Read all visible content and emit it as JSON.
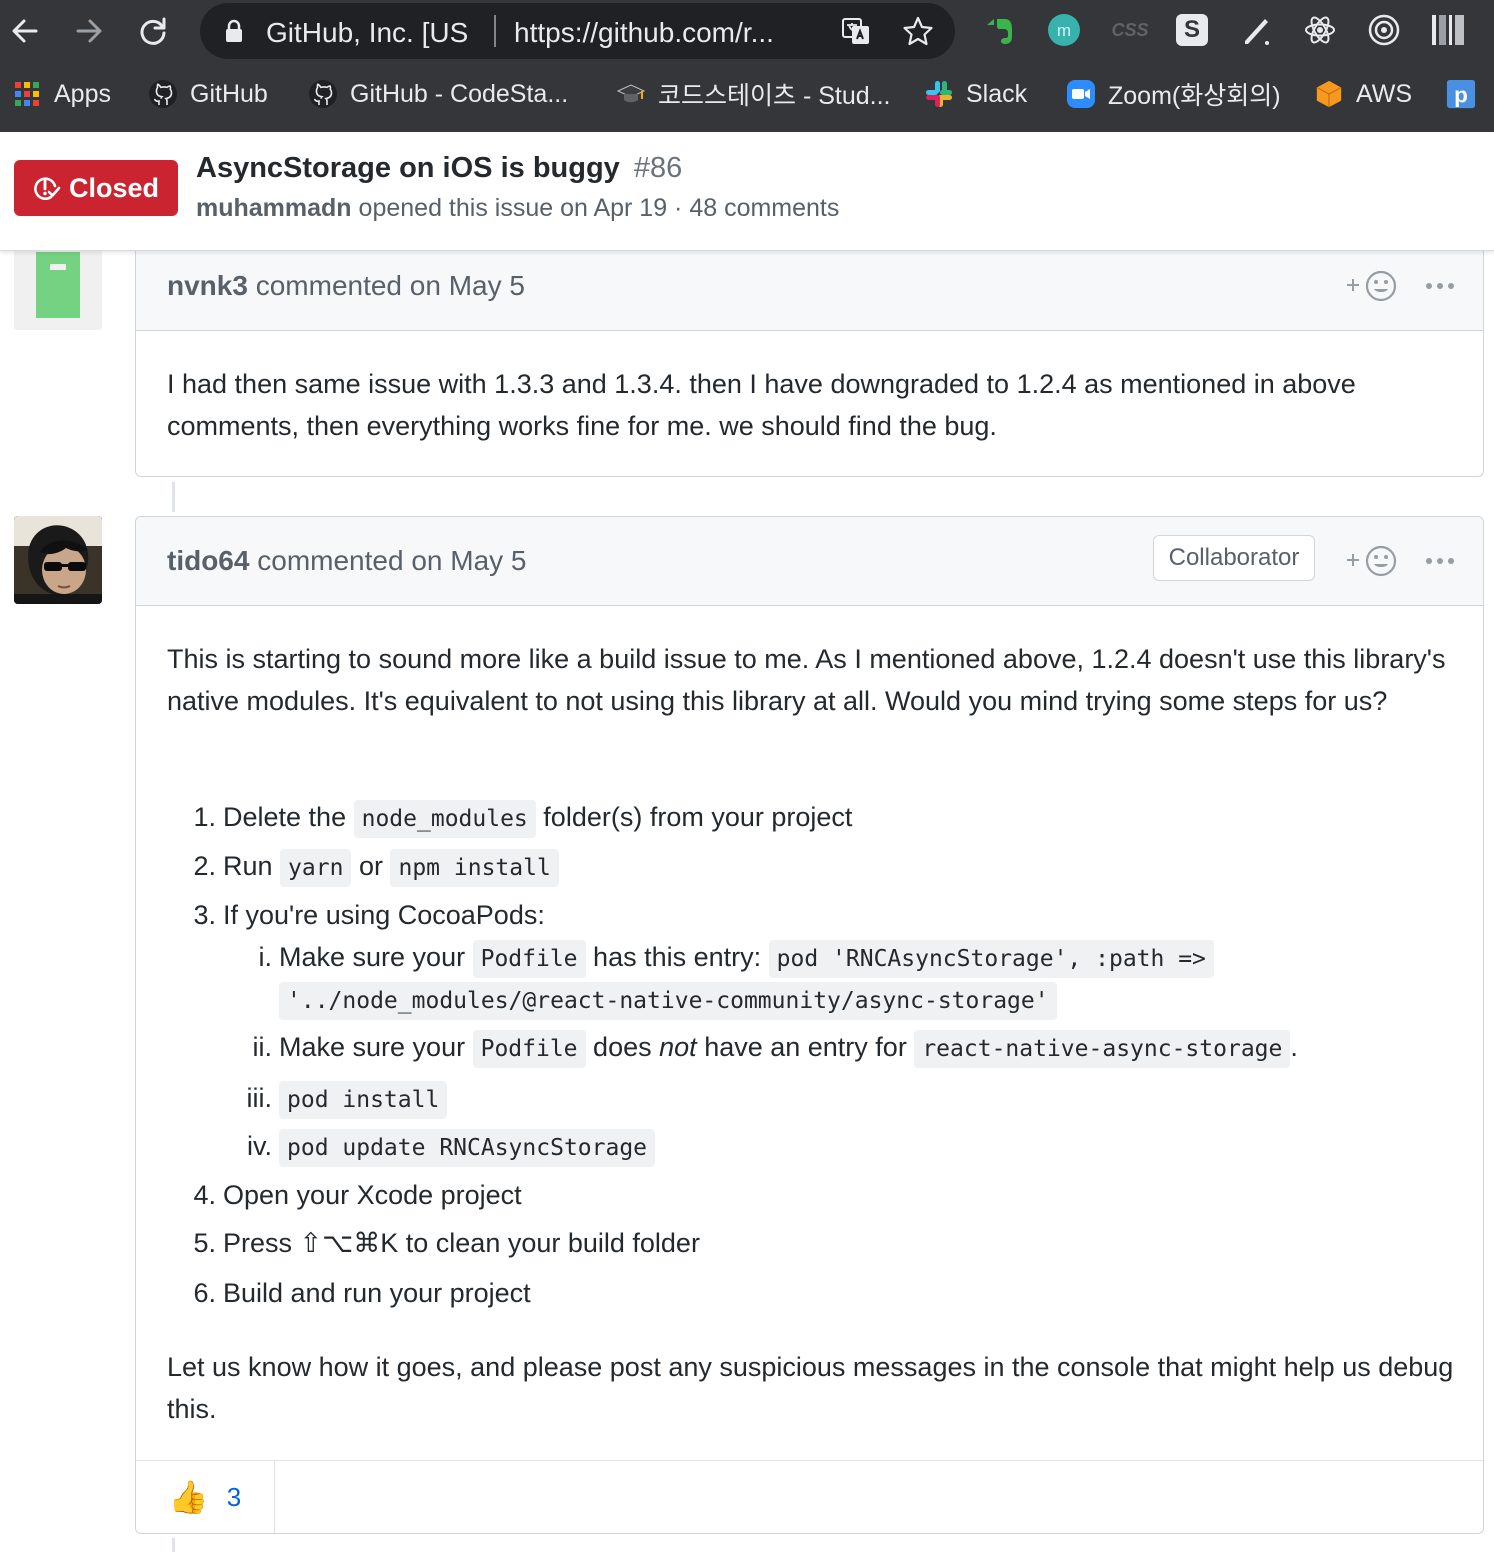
{
  "browser": {
    "omnibox": {
      "site": "GitHub, Inc. [US",
      "url": "https://github.com/r..."
    },
    "bookmarks": [
      {
        "label": "Apps"
      },
      {
        "label": "GitHub"
      },
      {
        "label": "GitHub - CodeSta..."
      },
      {
        "label": "코드스테이츠 - Stud..."
      },
      {
        "label": "Slack"
      },
      {
        "label": "Zoom(화상회의)"
      },
      {
        "label": "AWS"
      }
    ],
    "extension_css_label": "CSS",
    "extension_s_label": "S"
  },
  "issue": {
    "state_label": "Closed",
    "title": "AsyncStorage on iOS is buggy",
    "number": "#86",
    "author": "muhammadn",
    "opened_text": "opened this issue on Apr 19 · 48 comments",
    "state_color": "#cb2431"
  },
  "comments": [
    {
      "author": "nvnk3",
      "commented": "commented on May 5",
      "body": "I had then same issue with 1.3.3 and 1.3.4. then I have downgraded to 1.2.4 as mentioned in above comments, then everything works fine for me. we should find the bug."
    },
    {
      "author": "tido64",
      "commented": "commented on May 5",
      "badge": "Collaborator",
      "intro": "This is starting to sound more like a build issue to me. As I mentioned above, 1.2.4 doesn't use this library's native modules. It's equivalent to not using this library at all. Would you mind trying some steps for us?",
      "steps": {
        "s1": {
          "num": "1.",
          "a": "Delete the",
          "code": "node_modules",
          "b": "folder(s) from your project"
        },
        "s2": {
          "num": "2.",
          "a": "Run",
          "code1": "yarn",
          "or": "or",
          "code2": "npm install"
        },
        "s3": {
          "num": "3.",
          "text": "If you're using CocoaPods:"
        },
        "s3i": {
          "num": "i.",
          "a": "Make sure your",
          "code1": "Podfile",
          "b": "has this entry:",
          "code2a": "pod 'RNCAsyncStorage', :path =>",
          "code2b": "'../node_modules/@react-native-community/async-storage'"
        },
        "s3ii": {
          "num": "ii.",
          "a": "Make sure your",
          "code1": "Podfile",
          "b": "does",
          "em": "not",
          "c": "have an entry for",
          "code2": "react-native-async-storage",
          "end": "."
        },
        "s3iii": {
          "num": "iii.",
          "code": "pod install"
        },
        "s3iv": {
          "num": "iv.",
          "code": "pod update RNCAsyncStorage"
        },
        "s4": {
          "num": "4.",
          "text": "Open your Xcode project"
        },
        "s5": {
          "num": "5.",
          "text": "Press ⇧⌥⌘K to clean your build folder"
        },
        "s6": {
          "num": "6.",
          "text": "Build and run your project"
        }
      },
      "outro": "Let us know how it goes, and please post any suspicious messages in the console that might help us debug this.",
      "reactions": {
        "emoji": "👍",
        "count": "3"
      }
    }
  ]
}
